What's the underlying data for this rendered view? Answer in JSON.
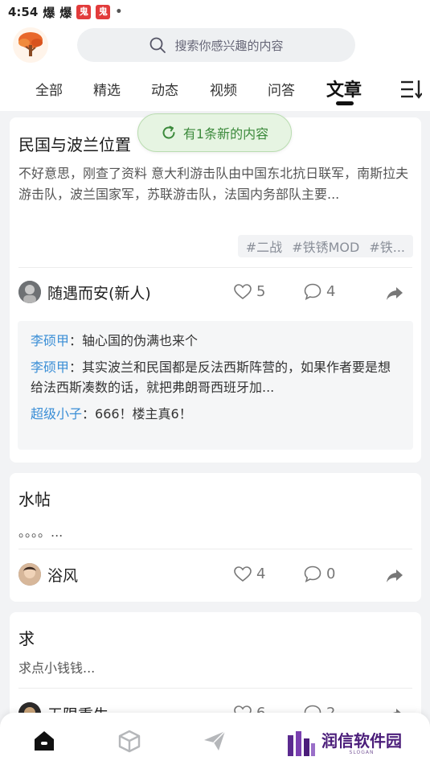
{
  "status_bar": {
    "time": "4:54",
    "icon_a": "爆",
    "icon_b": "爆",
    "icon_c": "鬼",
    "icon_d": "鬼",
    "dot": "•"
  },
  "header": {
    "search_placeholder": "搜索你感兴趣的内容",
    "tabs": [
      {
        "label": "全部"
      },
      {
        "label": "精选"
      },
      {
        "label": "动态"
      },
      {
        "label": "视频"
      },
      {
        "label": "问答"
      },
      {
        "label": "文章",
        "active": true
      }
    ]
  },
  "toast": {
    "label": "有1条新的内容"
  },
  "posts": [
    {
      "title": "民国与波兰位置",
      "body": "不好意思，刚查了资料 意大利游击队由中国东北抗日联军，南斯拉夫游击队，波兰国家军，苏联游击队，法国内务部队主要...",
      "tags": [
        "#二战",
        "#铁锈MOD",
        "#铁..."
      ],
      "author": "随遇而安(新人)",
      "likes": "5",
      "comments_count": "4",
      "comments": [
        {
          "user": "李硕甲",
          "text": "：轴心国的伪满也来个"
        },
        {
          "user": "李硕甲",
          "text": "：其实波兰和民国都是反法西斯阵营的，如果作者要是想给法西斯凑数的话，就把弗朗哥西班牙加..."
        },
        {
          "user": "超级小子",
          "text": "：666！楼主真6！"
        }
      ]
    },
    {
      "title": "水帖",
      "body": "。。。。...",
      "author": "浴风",
      "likes": "4",
      "comments_count": "0"
    },
    {
      "title": "求",
      "body": "求点小钱钱...",
      "author": "无限重生",
      "likes": "6",
      "comments_count": "2"
    }
  ],
  "bottom_nav": {
    "items": [
      "home-icon",
      "box-icon",
      "send-icon"
    ]
  },
  "watermark": {
    "brand": "润信软件园",
    "slogan": "SLOGAN"
  },
  "colors": {
    "accent_link": "#3a8ed6",
    "toast_green": "#3c8a3c",
    "watermark_purple": "#4b1d7a"
  }
}
